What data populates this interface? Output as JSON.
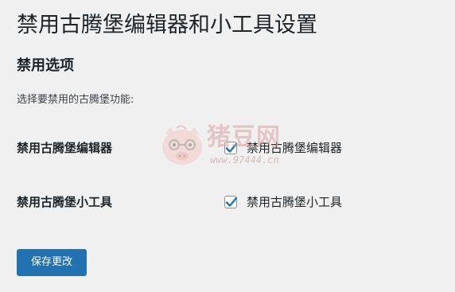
{
  "page": {
    "title": "禁用古腾堡编辑器和小工具设置"
  },
  "section": {
    "title": "禁用选项",
    "description": "选择要禁用的古腾堡功能:"
  },
  "options": [
    {
      "row_label": "禁用古腾堡编辑器",
      "checkbox_label": "禁用古腾堡编辑器",
      "checked": true
    },
    {
      "row_label": "禁用古腾堡小工具",
      "checkbox_label": "禁用古腾堡小工具",
      "checked": true
    }
  ],
  "save_button": {
    "label": "保存更改"
  },
  "watermark": {
    "brand": "猪豆网",
    "url": "www.97444.cn"
  },
  "colors": {
    "background": "#f0f0f1",
    "primary": "#2271b1",
    "text": "#1d2327"
  }
}
